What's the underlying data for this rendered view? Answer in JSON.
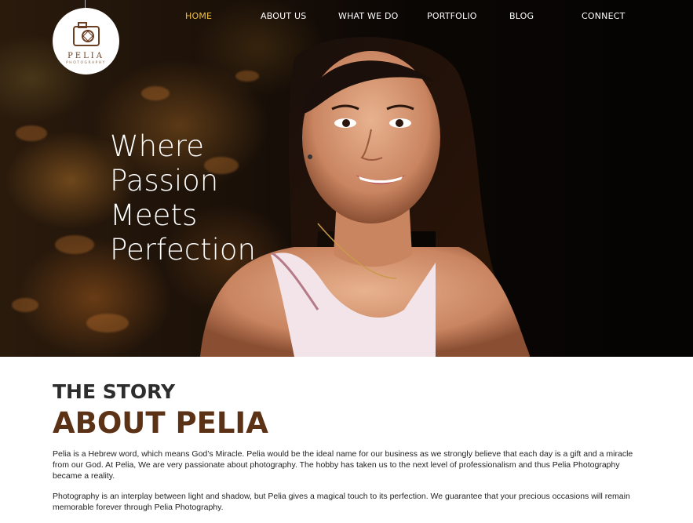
{
  "nav": {
    "items": [
      {
        "label": "HOME",
        "active": true
      },
      {
        "label": "ABOUT US",
        "active": false
      },
      {
        "label": "WHAT WE DO",
        "active": false
      },
      {
        "label": "PORTFOLIO",
        "active": false
      },
      {
        "label": "BLOG",
        "active": false
      },
      {
        "label": "CONNECT",
        "active": false
      }
    ],
    "active_color": "#f0c040"
  },
  "logo": {
    "name": "PELIA",
    "subtitle": "PHOTOGRAPHY",
    "icon": "camera-icon"
  },
  "hero": {
    "tagline_lines": [
      "Where",
      "Passion",
      "Meets",
      "Perfection"
    ]
  },
  "story": {
    "kicker": "THE STORY",
    "title": "ABOUT PELIA",
    "paragraphs": [
      "Pelia is a Hebrew word, which means God’s Miracle. Pelia would be the ideal name for our business as we strongly believe that each day is a gift and a miracle from our God. At Pelia, We are very passionate about photography.  The hobby has taken us to the next level of professionalism and thus Pelia Photography became a reality.",
      "Photography is an interplay between light and shadow, but Pelia gives a magical touch to its perfection. We guarantee that your precious occasions will remain memorable forever through Pelia Photography."
    ],
    "title_color": "#5c3217"
  }
}
